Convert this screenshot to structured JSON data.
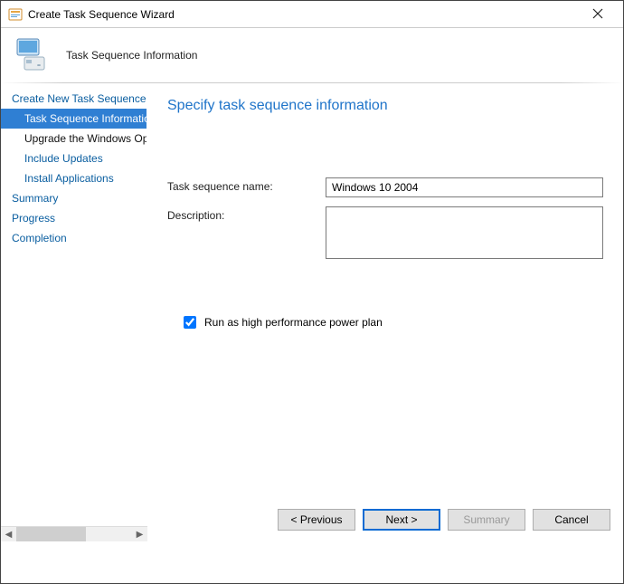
{
  "window": {
    "title": "Create Task Sequence Wizard"
  },
  "header": {
    "heading": "Task Sequence Information"
  },
  "sidebar": {
    "items": [
      {
        "label": "Create New Task Sequence"
      },
      {
        "label": "Task Sequence Information"
      },
      {
        "label": "Upgrade the Windows Op"
      },
      {
        "label": "Include Updates"
      },
      {
        "label": "Install Applications"
      },
      {
        "label": "Summary"
      },
      {
        "label": "Progress"
      },
      {
        "label": "Completion"
      }
    ]
  },
  "main": {
    "page_title": "Specify task sequence information",
    "label_name": "Task sequence name:",
    "value_name": "Windows 10 2004",
    "label_desc": "Description:",
    "value_desc": "",
    "checkbox_label": "Run as high performance power plan",
    "checkbox_checked": true
  },
  "buttons": {
    "previous": "< Previous",
    "next": "Next >",
    "summary": "Summary",
    "cancel": "Cancel"
  }
}
